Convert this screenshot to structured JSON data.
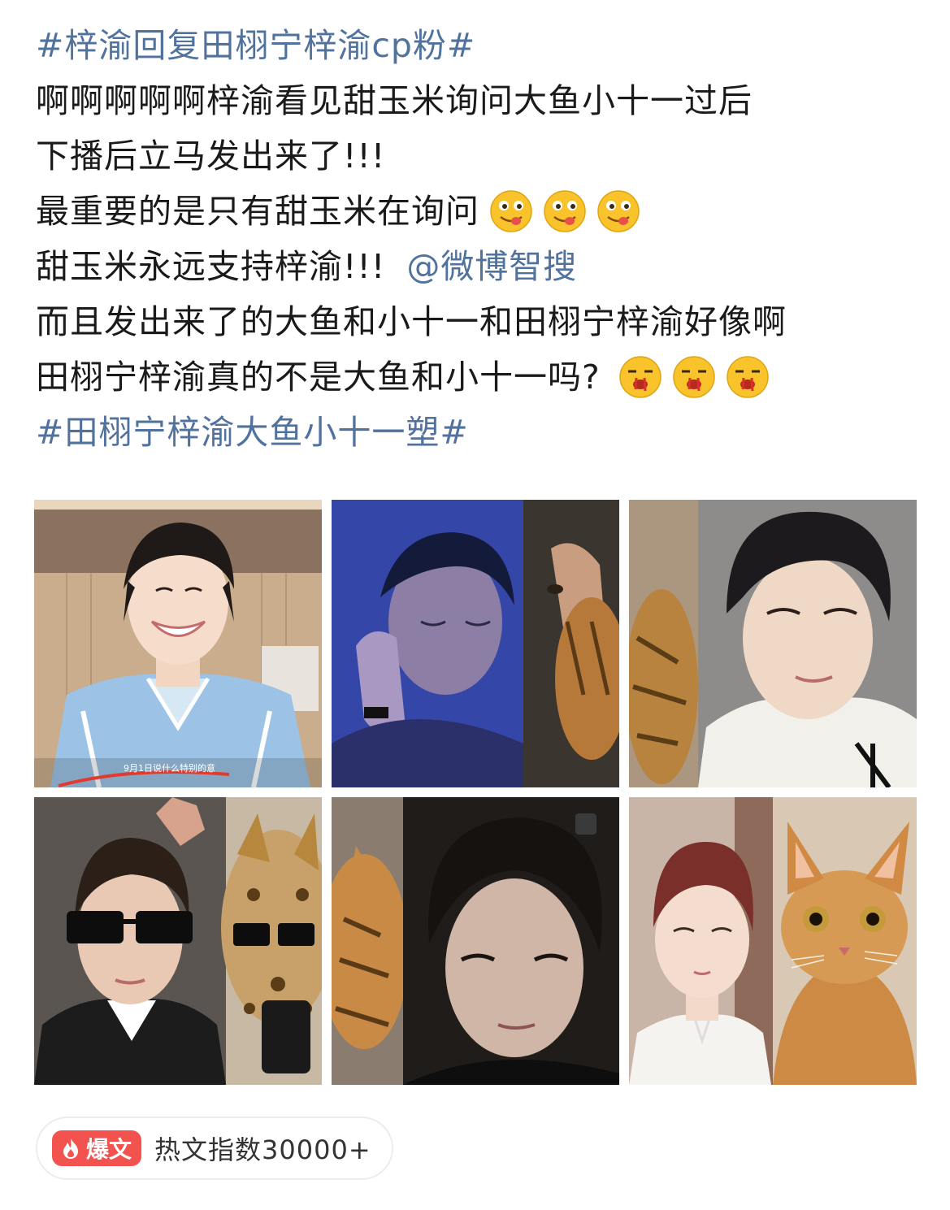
{
  "post": {
    "line1_hashtag": "#梓渝回复田栩宁梓渝cp粉#",
    "line2": "啊啊啊啊啊梓渝看见甜玉米询问大鱼小十一过后",
    "line3": "下播后立马发出来了!!!",
    "line4": "最重要的是只有甜玉米在询问",
    "line5_text": "甜玉米永远支持梓渝!!!",
    "line5_mention": "@微博智搜",
    "line6": "而且发出来了的大鱼和小十一和田栩宁梓渝好像啊",
    "line7": "田栩宁梓渝真的不是大鱼和小十一吗?",
    "line8_hashtag": "#田栩宁梓渝大鱼小十一塑#"
  },
  "emojis": {
    "line4": [
      "drooling-face-emoji",
      "drooling-face-emoji",
      "drooling-face-emoji"
    ],
    "line7": [
      "nosebleed-face-emoji",
      "nosebleed-face-emoji",
      "nosebleed-face-emoji"
    ]
  },
  "photos": [
    {
      "label": "smiling-boy-in-blue-shirt-photo",
      "caption": "9月1日说什么特别的意"
    },
    {
      "label": "sleeping-boy-and-cat-photo"
    },
    {
      "label": "man-in-white-shirt-photo"
    },
    {
      "label": "boy-in-sunglasses-and-cat-photo"
    },
    {
      "label": "cat-and-man-closeup-photo"
    },
    {
      "label": "red-haired-boy-and-kitten-photo"
    }
  ],
  "badge": {
    "tag_label": "爆文",
    "index_text": "热文指数30000+"
  },
  "colors": {
    "link": "#52729e",
    "hot_tag": "#f2534f"
  }
}
